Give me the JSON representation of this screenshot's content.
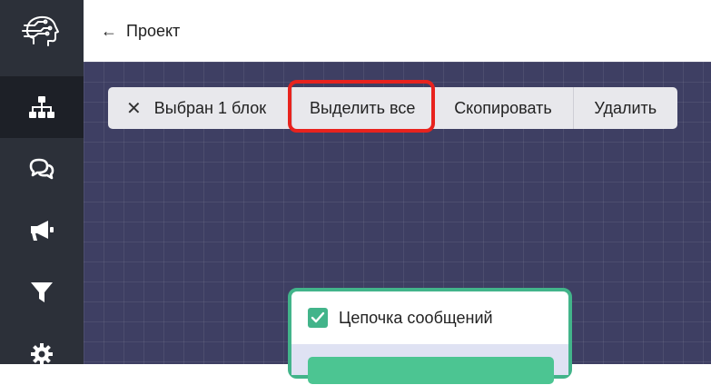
{
  "header": {
    "back_icon": "arrow-left-icon",
    "title": "Проект"
  },
  "sidebar": {
    "items": [
      {
        "name": "sitemap-icon",
        "active": true
      },
      {
        "name": "chat-bubbles-icon",
        "active": false
      },
      {
        "name": "megaphone-icon",
        "active": false
      },
      {
        "name": "filter-icon",
        "active": false
      },
      {
        "name": "gear-icon",
        "active": false
      }
    ]
  },
  "toolbar": {
    "selected_label": "Выбран 1 блок",
    "select_all_label": "Выделить все",
    "copy_label": "Скопировать",
    "delete_label": "Удалить"
  },
  "node": {
    "title": "Цепочка сообщений",
    "checked": true
  },
  "colors": {
    "sidebar": "#2c3039",
    "canvas": "#3e3f63",
    "highlight": "#e8231e",
    "node_accent": "#42b48a"
  }
}
